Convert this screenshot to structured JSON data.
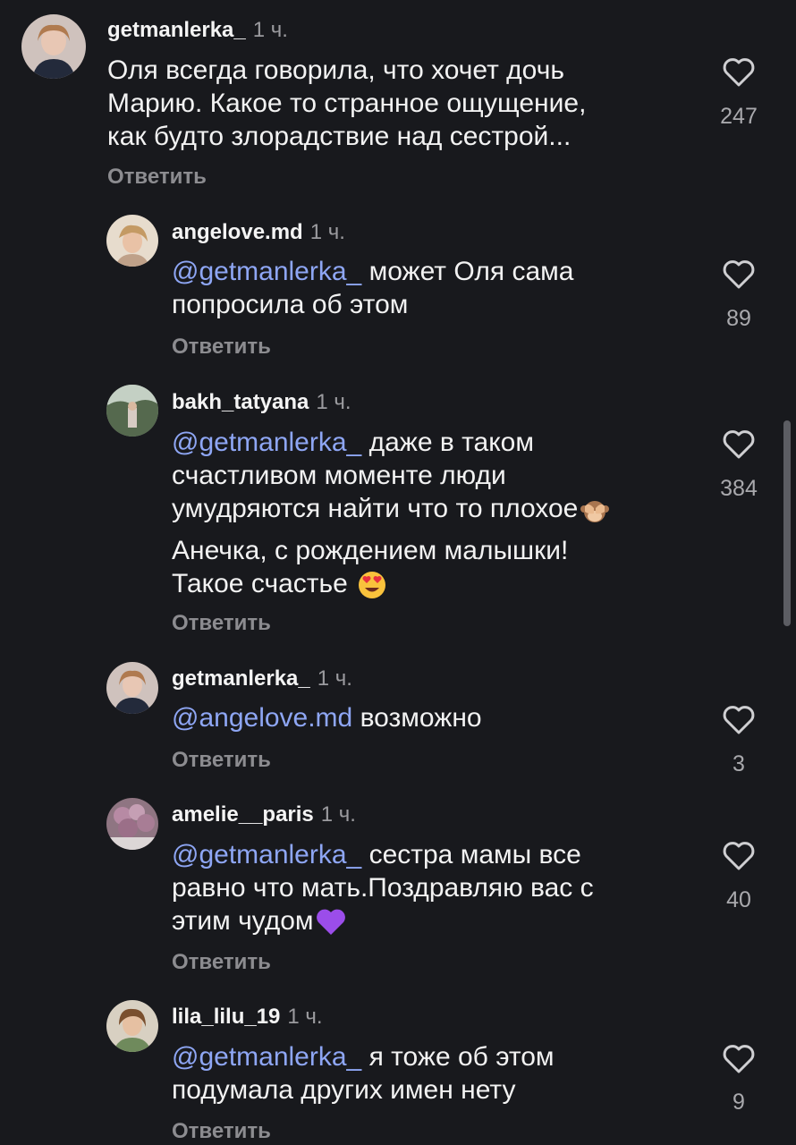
{
  "reply_label": "Ответить",
  "comments": [
    {
      "username": "getmanlerka_",
      "time": "1 ч.",
      "mention": "",
      "lines": [
        "Оля всегда говорила, что хочет дочь",
        "Марию. Какое то странное ощущение,",
        "как будто злорадствие над сестрой..."
      ],
      "likes": "247"
    },
    {
      "username": "angelove.md",
      "time": "1 ч.",
      "mention": "@getmanlerka_",
      "lines": [
        " может Оля сама",
        "попросила об этом"
      ],
      "likes": "89"
    },
    {
      "username": "bakh_tatyana",
      "time": "1 ч.",
      "mention": "@getmanlerka_",
      "lines": [
        " даже в таком",
        "счастливом моменте люди",
        "умудряются найти что то плохое",
        "Анечка, с рождением малышки!",
        "Такое счастье "
      ],
      "emojis": [
        "see-no-evil-monkey-emoji",
        "heart-eyes-emoji"
      ],
      "likes": "384"
    },
    {
      "username": "getmanlerka_",
      "time": "1 ч.",
      "mention": "@angelove.md",
      "lines": [
        " возможно"
      ],
      "likes": "3"
    },
    {
      "username": "amelie__paris",
      "time": "1 ч.",
      "mention": "@getmanlerka_",
      "lines": [
        " сестра мамы все",
        "равно что мать.Поздравляю вас с",
        "этим чудом"
      ],
      "emojis": [
        "purple-heart-emoji"
      ],
      "likes": "40"
    },
    {
      "username": "lila_lilu_19",
      "time": "1 ч.",
      "mention": "@getmanlerka_",
      "lines": [
        " я тоже об этом",
        "подумала других имен нету"
      ],
      "likes": "9"
    }
  ],
  "icons": {
    "like": "heart-outline-icon"
  },
  "colors": {
    "background": "#18191d",
    "mention": "#8ea6f4",
    "muted": "#8c8c90"
  }
}
